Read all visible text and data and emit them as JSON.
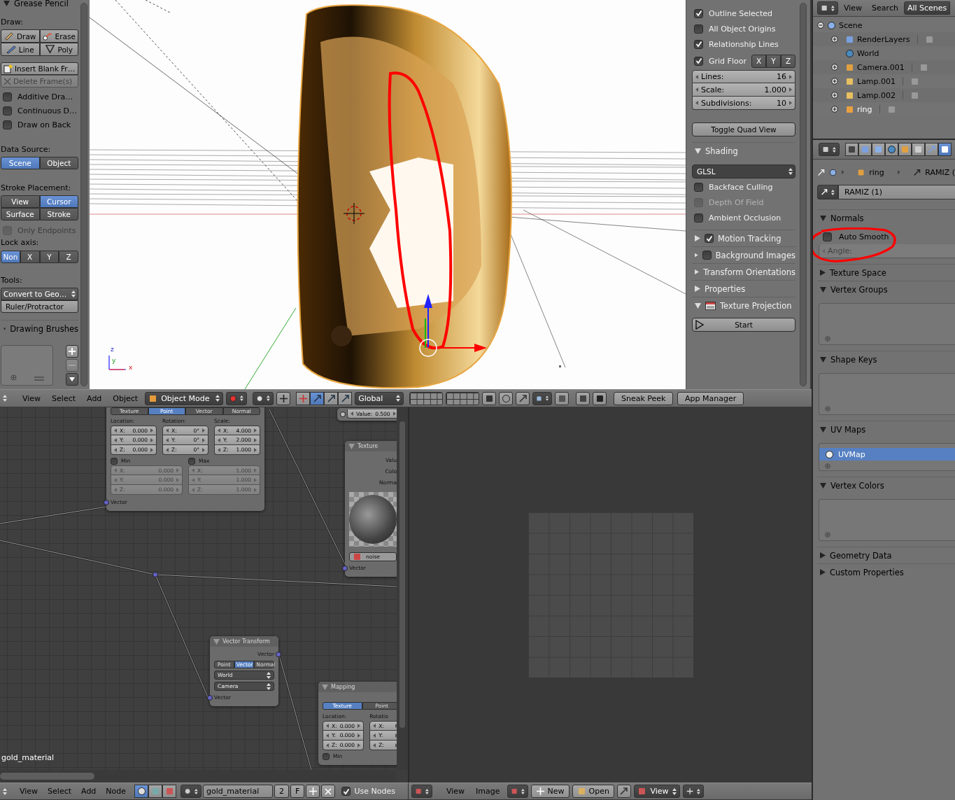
{
  "tool_shelf": {
    "title": {
      "label": "Grease Pencil",
      "expanded": true
    },
    "draw_label": "Draw:",
    "draw_tools": [
      "Draw",
      "Erase",
      "Line",
      "Poly"
    ],
    "frame_buttons": [
      {
        "label": "Insert Blank Fr…",
        "disabled": false
      },
      {
        "label": "Delete Frame(s)",
        "disabled": true
      }
    ],
    "options": [
      {
        "label": "Additive Dra…",
        "checked": false
      },
      {
        "label": "Continuous D…",
        "checked": false
      },
      {
        "label": "Draw on Back",
        "checked": false
      }
    ],
    "data_source": {
      "label": "Data Source:",
      "options": [
        {
          "label": "Scene",
          "selected": true
        },
        {
          "label": "Object",
          "selected": false
        }
      ]
    },
    "stroke_placement": {
      "label": "Stroke Placement:",
      "options": [
        {
          "label": "View",
          "selected": false
        },
        {
          "label": "Cursor",
          "selected": true
        },
        {
          "label": "Surface",
          "selected": false
        },
        {
          "label": "Stroke",
          "selected": false
        }
      ]
    },
    "only_endpoints": {
      "label": "Only Endpoints",
      "checked": false,
      "disabled": true
    },
    "lock_axis": {
      "label": "Lock axis:",
      "options": [
        {
          "label": "Non",
          "selected": true
        },
        {
          "label": "X",
          "selected": false
        },
        {
          "label": "Y",
          "selected": false
        },
        {
          "label": "Z",
          "selected": false
        }
      ]
    },
    "tools_label": "Tools:",
    "convert": "Convert to Geo…",
    "ruler": "Ruler/Protractor",
    "brushes": {
      "label": "Drawing Brushes",
      "expanded": true
    }
  },
  "viewport": {
    "axis_labels": [
      "z",
      "y",
      "x"
    ]
  },
  "view_panel": {
    "checks": [
      {
        "label": "Outline Selected",
        "checked": true
      },
      {
        "label": "All Object Origins",
        "checked": false
      },
      {
        "label": "Relationship Lines",
        "checked": true
      },
      {
        "label": "Grid Floor",
        "checked": true
      }
    ],
    "grid_axes": [
      "X",
      "Y",
      "Z"
    ],
    "fields": [
      {
        "label": "Lines:",
        "value": "16"
      },
      {
        "label": "Scale:",
        "value": "1.000"
      },
      {
        "label": "Subdivisions:",
        "value": "10"
      }
    ],
    "quad_button": "Toggle Quad View",
    "shading": {
      "label": "Shading",
      "expanded": true,
      "mode": "GLSL",
      "options": [
        {
          "label": "Backface Culling",
          "checked": false,
          "disabled": false
        },
        {
          "label": "Depth Of Field",
          "checked": false,
          "disabled": true
        },
        {
          "label": "Ambient Occlusion",
          "checked": false,
          "disabled": false
        }
      ]
    },
    "panels": [
      {
        "label": "Motion Tracking",
        "expanded": false,
        "kind": "check",
        "checked": true
      },
      {
        "label": "Background Images",
        "expanded": false,
        "kind": "check",
        "checked": false
      },
      {
        "label": "Transform Orientations",
        "expanded": false,
        "kind": "plain"
      },
      {
        "label": "Properties",
        "expanded": false,
        "kind": "plain"
      },
      {
        "label": "Texture Projection",
        "expanded": true,
        "kind": "icon"
      }
    ],
    "start_button": "Start"
  },
  "viewport_header": {
    "menus": [
      "View",
      "Select",
      "Add",
      "Object"
    ],
    "mode": "Object Mode",
    "manipulators": [
      {
        "selected": false
      },
      {
        "selected": true
      },
      {
        "selected": false
      },
      {
        "selected": false
      }
    ],
    "orientation": "Global",
    "buttons": [
      "Sneak Peek",
      "App Manager"
    ]
  },
  "node_editor": {
    "material_label": "gold_material",
    "nodes": [
      {
        "kind": "mapping_partial",
        "tabs": [
          {
            "label": "Texture",
            "selected": false
          },
          {
            "label": "Point",
            "selected": true
          },
          {
            "label": "Vector",
            "selected": false
          },
          {
            "label": "Normal",
            "selected": false
          }
        ],
        "columns": [
          {
            "label": "Location:",
            "rows": [
              {
                "axis": "X:",
                "value": "0.000"
              },
              {
                "axis": "Y:",
                "value": "0.000"
              },
              {
                "axis": "Z:",
                "value": "0.000"
              }
            ]
          },
          {
            "label": "Rotation:",
            "rows": [
              {
                "axis": "X:",
                "value": "0°"
              },
              {
                "axis": "Y:",
                "value": "0°"
              },
              {
                "axis": "Z:",
                "value": "0°"
              }
            ]
          },
          {
            "label": "Scale:",
            "rows": [
              {
                "axis": "X:",
                "value": "4.000"
              },
              {
                "axis": "Y:",
                "value": "2.000"
              },
              {
                "axis": "Z:",
                "value": "1.000"
              }
            ]
          }
        ],
        "limits": [
          {
            "label": "Min",
            "checked": false,
            "rows": [
              {
                "axis": "X:",
                "value": "0.000"
              },
              {
                "axis": "Y:",
                "value": "0.000"
              },
              {
                "axis": "Z:",
                "value": "0.000"
              }
            ]
          },
          {
            "label": "Max",
            "checked": false,
            "rows": [
              {
                "axis": "X:",
                "value": "1.000"
              },
              {
                "axis": "Y:",
                "value": "1.000"
              },
              {
                "axis": "Z:",
                "value": "1.000"
              }
            ]
          }
        ],
        "input": "Vector"
      },
      {
        "kind": "value",
        "label": "Value:",
        "value": "0.500"
      },
      {
        "kind": "texture",
        "title": "Texture",
        "outputs": [
          "Valu",
          "Colo",
          "Norma"
        ],
        "texture": "noise",
        "input": "Vector"
      },
      {
        "kind": "vector_transform",
        "title": "Vector Transform",
        "output": "Vector",
        "tabs": [
          {
            "label": "Point",
            "selected": false
          },
          {
            "label": "Vector",
            "selected": true
          },
          {
            "label": "Normal",
            "selected": false
          }
        ],
        "dropdowns": [
          "World",
          "Camera"
        ],
        "input": "Vector"
      },
      {
        "kind": "mapping",
        "title": "Mapping",
        "tabs": [
          {
            "label": "Texture",
            "selected": true
          },
          {
            "label": "Point",
            "selected": false
          }
        ],
        "columns": [
          {
            "label": "Location:",
            "rows": [
              {
                "axis": "X:",
                "value": "0.000"
              },
              {
                "axis": "Y:",
                "value": "0.000"
              },
              {
                "axis": "Z:",
                "value": "0.000"
              }
            ]
          },
          {
            "label": "Rotatio",
            "rows": [
              {
                "axis": "X:"
              },
              {
                "axis": "Y:"
              },
              {
                "axis": "Z:"
              }
            ]
          }
        ],
        "min": {
          "label": "Min",
          "checked": false
        }
      }
    ]
  },
  "node_header": {
    "menus": [
      "View",
      "Select",
      "Add",
      "Node"
    ],
    "shader_types": [
      {
        "selected": true
      },
      {
        "selected": false
      },
      {
        "selected": false
      }
    ],
    "material": "gold_material",
    "users": "2",
    "fake_user": "F",
    "use_nodes": {
      "label": "Use Nodes",
      "checked": true
    }
  },
  "image_header": {
    "menus": [
      "View",
      "Image"
    ],
    "new_button": "New",
    "open_button": "Open",
    "view_menu": "View"
  },
  "outliner": {
    "menus": [
      "View",
      "Search"
    ],
    "scope": "All Scenes",
    "tree": [
      {
        "label": "Scene",
        "expanded": true,
        "children": [
          {
            "label": "RenderLayers",
            "kind": "branch",
            "expanded": false,
            "selected": false
          },
          {
            "label": "World",
            "kind": "leaf",
            "selected": false
          },
          {
            "label": "Camera.001",
            "kind": "branch",
            "expanded": false,
            "selected": false
          },
          {
            "label": "Lamp.001",
            "kind": "branch",
            "expanded": false,
            "selected": false
          },
          {
            "label": "Lamp.002",
            "kind": "branch",
            "expanded": false,
            "selected": false
          },
          {
            "label": "ring",
            "kind": "branch",
            "expanded": false,
            "selected": true
          }
        ]
      }
    ]
  },
  "properties": {
    "tabs": [
      {
        "selected": false
      },
      {
        "selected": false
      },
      {
        "selected": false
      },
      {
        "selected": false
      },
      {
        "selected": false
      },
      {
        "selected": false
      },
      {
        "selected": false
      },
      {
        "selected": true
      }
    ],
    "breadcrumb": [
      "ring",
      "RAMIZ ("
    ],
    "mesh": "RAMIZ (1)",
    "panels": [
      {
        "label": "Normals",
        "expanded": true,
        "kind": "normals",
        "auto_smooth": {
          "label": "Auto Smooth",
          "checked": false
        },
        "angle_label": "Angle:"
      },
      {
        "label": "Texture Space",
        "expanded": false,
        "kind": "plain"
      },
      {
        "label": "Vertex Groups",
        "expanded": true,
        "kind": "list"
      },
      {
        "label": "Shape Keys",
        "expanded": true,
        "kind": "list"
      },
      {
        "label": "UV Maps",
        "expanded": true,
        "kind": "uv",
        "item": {
          "label": "UVMap",
          "selected": true
        }
      },
      {
        "label": "Vertex Colors",
        "expanded": true,
        "kind": "list"
      },
      {
        "label": "Geometry Data",
        "expanded": false,
        "kind": "plain"
      },
      {
        "label": "Custom Properties",
        "expanded": false,
        "kind": "plain"
      }
    ]
  }
}
